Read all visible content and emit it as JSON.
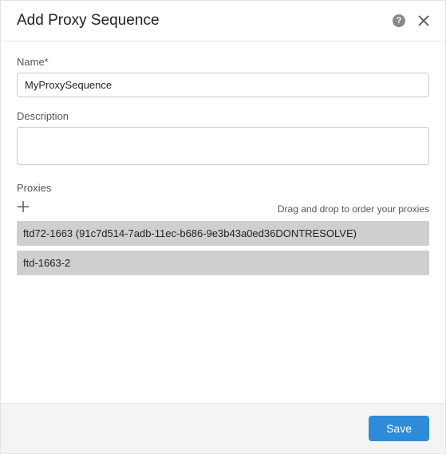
{
  "header": {
    "title": "Add Proxy Sequence"
  },
  "fields": {
    "name_label": "Name*",
    "name_value": "MyProxySequence",
    "description_label": "Description",
    "description_value": "",
    "proxies_label": "Proxies",
    "drag_hint": "Drag and drop to order your proxies"
  },
  "proxies": [
    {
      "label": "ftd72-1663 (91c7d514-7adb-11ec-b686-9e3b43a0ed36DONTRESOLVE)"
    },
    {
      "label": "ftd-1663-2"
    }
  ],
  "footer": {
    "save_label": "Save"
  }
}
